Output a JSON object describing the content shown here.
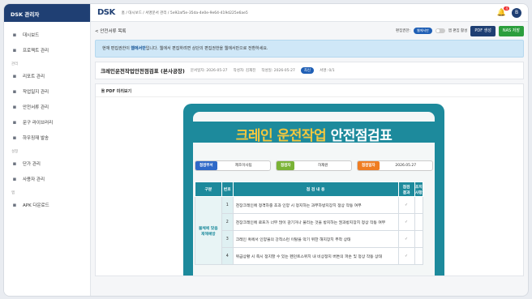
{
  "brand": "DSK 관리자",
  "nav": [
    {
      "label": "대시보드",
      "icon": "grid-icon"
    },
    {
      "label": "프로젝트 관리",
      "icon": "folder-icon"
    },
    {
      "section": "관리"
    },
    {
      "label": "리포트 관리",
      "icon": "document-icon"
    },
    {
      "label": "작업일지 관리",
      "icon": "document-icon"
    },
    {
      "label": "안전서류 관리",
      "icon": "shield-icon"
    },
    {
      "label": "문구 라이브러리",
      "icon": "comment-icon"
    },
    {
      "label": "하우징재 발송",
      "icon": "truck-icon"
    },
    {
      "section": "설정"
    },
    {
      "label": "단가 관리",
      "icon": "price-icon"
    },
    {
      "label": "사용자 관리",
      "icon": "users-icon"
    },
    {
      "section": "앱"
    },
    {
      "label": "APK 다운로드",
      "icon": "download-icon"
    }
  ],
  "topbar": {
    "logo": "DSK",
    "breadcrumb": "홈 / 대시보드 / 서명문서 관리 / 5e92af5e-35da-4e0e-9e64-419d225e6ae5",
    "notify_count": "4",
    "avatar": "B"
  },
  "toolbar": {
    "back": "< 안전서류 목록",
    "edit_label": "편집권한:",
    "edit_role": "웹에서만",
    "mobile_edit": "앱 편집 활성",
    "pdf": "PDF 생성",
    "nas": "NAS 저장"
  },
  "banner": {
    "prefix": "현재 편집권한이 ",
    "role": "웹에서만",
    "suffix": "입니다. 웹에서 편집하려면 상단의 편집권한을 웹에서만으로 전환하세요."
  },
  "doc": {
    "title": "크레인운전작업안전점검표 (본사공장)",
    "meta1": "문서일자: 2026-05-27",
    "meta2": "작성자: 김재진",
    "meta3": "작성일: 2026-05-27",
    "version": "최신",
    "signs": "서명: 0/1"
  },
  "preview": {
    "label": "PDF 미리보기"
  },
  "sheet": {
    "title1": "크레인",
    "title2": "운전작업",
    "title3": "안전점검표",
    "dept_label": "점검부서",
    "dept": "제조이사팀",
    "insp_label": "점검자",
    "insp": "하재원",
    "date_label": "점검일자",
    "date": "2026.05.27",
    "headers": [
      "구분",
      "번호",
      "점 검 내 용",
      "점검\n결과",
      "조치\n사항"
    ],
    "category": "물체에 맞음\n재해예방",
    "rows": [
      {
        "no": "1",
        "text": "천장크레인에 정격하중 초과 인양 시 정지하는 과부하방지장치 정상 작동 여부",
        "check": "✓"
      },
      {
        "no": "2",
        "text": "천장크레인에 로프가 너무 많이 감기거나 풀리는 것을 방지하는 권과방지장치 정상 작동 여부",
        "check": "✓"
      },
      {
        "no": "3",
        "text": "크레인 혹에서 인양물의 강착스런 이탈을 막기 위한 해지장치 부착 상태",
        "check": "✓"
      },
      {
        "no": "4",
        "text": "위급상황 시 즉시 정지할 수 있는 펜던트스위치 내 비상정지 버튼의 파손 및 정상 작동 상태",
        "check": "✓"
      }
    ]
  }
}
